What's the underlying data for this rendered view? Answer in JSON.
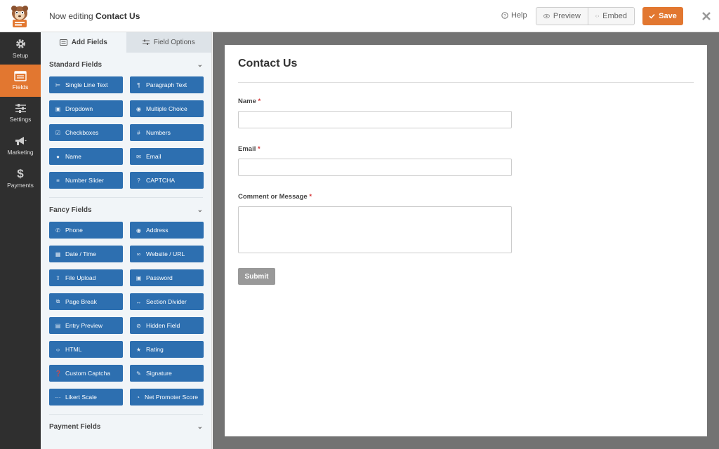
{
  "header": {
    "editing_prefix": "Now editing",
    "form_name": "Contact Us",
    "help_label": "Help",
    "preview_label": "Preview",
    "embed_label": "Embed",
    "save_label": "Save",
    "close_icon": "close-icon"
  },
  "leftnav": {
    "items": [
      {
        "label": "Setup",
        "icon": "gear-icon",
        "active": false
      },
      {
        "label": "Fields",
        "icon": "fields-icon",
        "active": true
      },
      {
        "label": "Settings",
        "icon": "sliders-icon",
        "active": false
      },
      {
        "label": "Marketing",
        "icon": "megaphone-icon",
        "active": false
      },
      {
        "label": "Payments",
        "icon": "dollar-icon",
        "active": false
      }
    ]
  },
  "panel": {
    "tabs": [
      {
        "label": "Add Fields",
        "active": true
      },
      {
        "label": "Field Options",
        "active": false
      }
    ],
    "sections": [
      {
        "title": "Standard Fields",
        "fields": [
          {
            "label": "Single Line Text",
            "icon": "text-icon"
          },
          {
            "label": "Paragraph Text",
            "icon": "paragraph-icon"
          },
          {
            "label": "Dropdown",
            "icon": "dropdown-icon"
          },
          {
            "label": "Multiple Choice",
            "icon": "radio-icon"
          },
          {
            "label": "Checkboxes",
            "icon": "checkbox-icon"
          },
          {
            "label": "Numbers",
            "icon": "hash-icon"
          },
          {
            "label": "Name",
            "icon": "user-icon"
          },
          {
            "label": "Email",
            "icon": "envelope-icon"
          },
          {
            "label": "Number Slider",
            "icon": "slider-icon"
          },
          {
            "label": "CAPTCHA",
            "icon": "question-icon"
          }
        ]
      },
      {
        "title": "Fancy Fields",
        "fields": [
          {
            "label": "Phone",
            "icon": "phone-icon"
          },
          {
            "label": "Address",
            "icon": "map-pin-icon"
          },
          {
            "label": "Date / Time",
            "icon": "calendar-icon"
          },
          {
            "label": "Website / URL",
            "icon": "link-icon"
          },
          {
            "label": "File Upload",
            "icon": "upload-icon"
          },
          {
            "label": "Password",
            "icon": "lock-icon"
          },
          {
            "label": "Page Break",
            "icon": "copy-icon"
          },
          {
            "label": "Section Divider",
            "icon": "arrows-h-icon"
          },
          {
            "label": "Entry Preview",
            "icon": "file-icon"
          },
          {
            "label": "Hidden Field",
            "icon": "eye-slash-icon"
          },
          {
            "label": "HTML",
            "icon": "code-icon"
          },
          {
            "label": "Rating",
            "icon": "star-icon"
          },
          {
            "label": "Custom Captcha",
            "icon": "question-circle-icon"
          },
          {
            "label": "Signature",
            "icon": "pen-icon"
          },
          {
            "label": "Likert Scale",
            "icon": "dots-icon"
          },
          {
            "label": "Net Promoter Score",
            "icon": "gauge-icon"
          }
        ]
      },
      {
        "title": "Payment Fields",
        "fields": []
      }
    ]
  },
  "form": {
    "title": "Contact Us",
    "fields": [
      {
        "label": "Name",
        "required_mark": "*"
      },
      {
        "label": "Email",
        "required_mark": "*"
      },
      {
        "label": "Comment or Message",
        "required_mark": "*"
      }
    ],
    "submit_label": "Submit"
  },
  "colors": {
    "accent": "#e27730",
    "field_button": "#2d6fb0",
    "nav_bg": "#2f2f2f",
    "canvas_bg": "#737373"
  }
}
